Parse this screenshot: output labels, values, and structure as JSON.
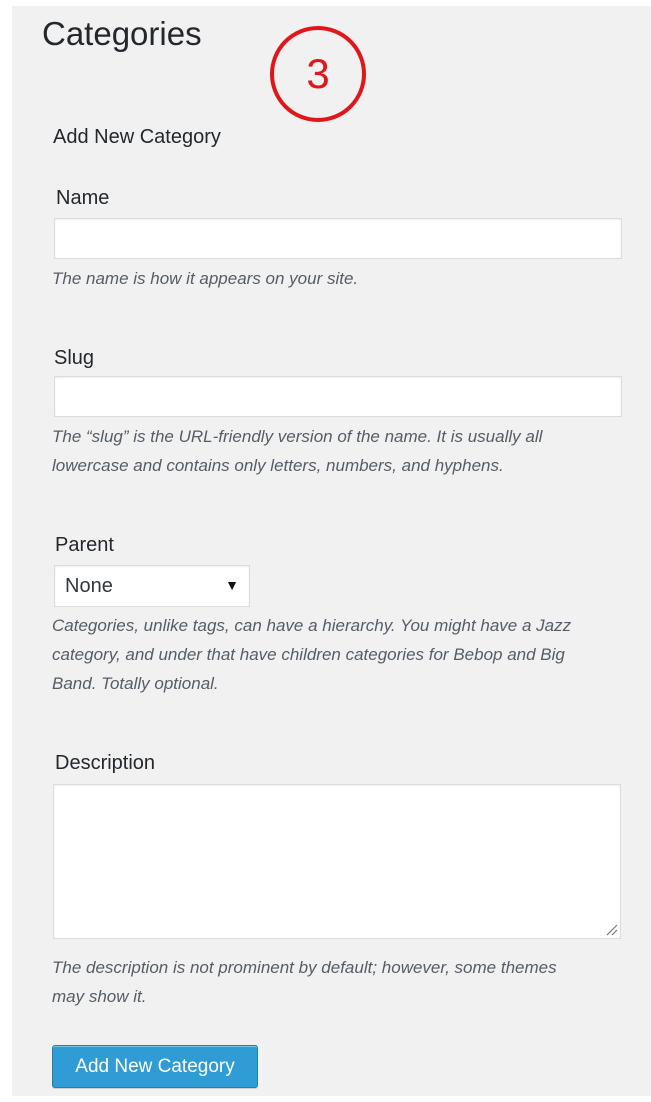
{
  "page": {
    "title": "Categories"
  },
  "annotation": {
    "number": "3",
    "color": "#e0161b"
  },
  "form": {
    "section_title": "Add New Category",
    "name": {
      "label": "Name",
      "value": "",
      "help": "The name is how it appears on your site."
    },
    "slug": {
      "label": "Slug",
      "value": "",
      "help_line1": "The “slug” is the URL-friendly version of the name. It is usually all",
      "help_line2": "lowercase and contains only letters, numbers, and hyphens."
    },
    "parent": {
      "label": "Parent",
      "selected": "None",
      "arrow": "▼",
      "help_line1": "Categories, unlike tags, can have a hierarchy. You might have a Jazz",
      "help_line2": "category, and under that have children categories for Bebop and Big",
      "help_line3": "Band. Totally optional."
    },
    "description": {
      "label": "Description",
      "value": "",
      "help_line1": "The description is not prominent by default; however, some themes",
      "help_line2": "may show it."
    },
    "submit_label": "Add New Category"
  },
  "colors": {
    "panel_background": "#f1f1f1",
    "button_primary": "#2f9cd5",
    "button_border": "#1f7fb3"
  },
  "icons": {
    "select_arrow": "triangle-down-icon",
    "resize_handle": "resize-grip-icon"
  }
}
